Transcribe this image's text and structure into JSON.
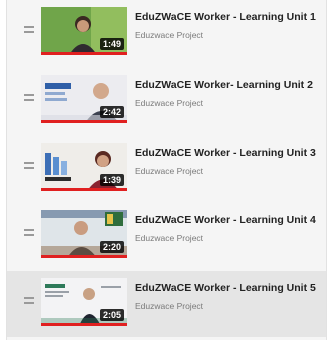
{
  "playlist": {
    "items": [
      {
        "title": "EduZWaCE Worker - Learning Unit 1",
        "channel": "Eduzwace Project",
        "duration": "1:49",
        "watched_fraction": 1.0,
        "active": false,
        "thumb_colors": {
          "bg": "#4f8a3c",
          "accent": "#b7d96b",
          "person": "#5b3a2a"
        }
      },
      {
        "title": "EduZWaCE Worker- Learning Unit 2",
        "channel": "Eduzwace Project",
        "duration": "2:42",
        "watched_fraction": 1.0,
        "active": false,
        "thumb_colors": {
          "bg": "#e8e8ec",
          "accent": "#2f5fa8",
          "person": "#3b3b44"
        }
      },
      {
        "title": "EduZWaCE Worker - Learning Unit 3",
        "channel": "Eduzwace Project",
        "duration": "1:39",
        "watched_fraction": 1.0,
        "active": false,
        "thumb_colors": {
          "bg": "#eceae6",
          "accent": "#3d6fb6",
          "person": "#7a1f2a"
        }
      },
      {
        "title": "EduZWaCE Worker - Learning Unit 4",
        "channel": "Eduzwace Project",
        "duration": "2:20",
        "watched_fraction": 1.0,
        "active": false,
        "thumb_colors": {
          "bg": "#dfe6ea",
          "accent": "#2f6d3c",
          "person": "#2a2f3a"
        }
      },
      {
        "title": "EduZWaCE Worker - Learning Unit 5",
        "channel": "Eduzwace Project",
        "duration": "2:05",
        "watched_fraction": 1.0,
        "active": true,
        "thumb_colors": {
          "bg": "#f2f2f4",
          "accent": "#2e7a5a",
          "person": "#1f2430"
        }
      }
    ]
  },
  "colors": {
    "progress": "#e02020",
    "active_row": "#e5e5e5"
  },
  "icons": {
    "drag_handle": "drag-handle-icon"
  }
}
